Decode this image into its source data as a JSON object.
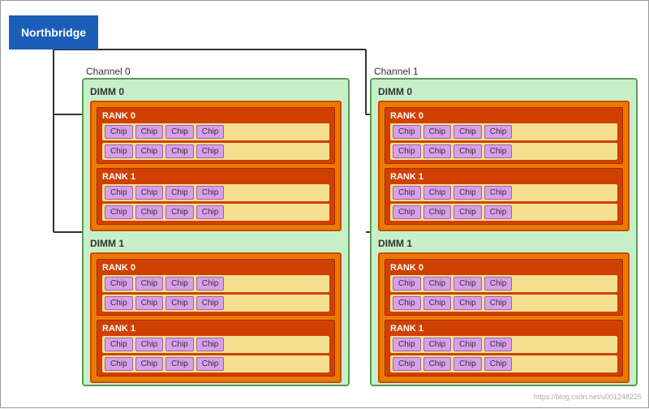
{
  "northbridge": {
    "label": "Northbridge"
  },
  "channels": [
    {
      "id": "channel-0",
      "label": "Channel 0",
      "dimms": [
        {
          "label": "DIMM 0",
          "ranks": [
            {
              "label": "RANK 0",
              "rows": [
                [
                  "Chip",
                  "Chip",
                  "Chip",
                  "Chip"
                ],
                [
                  "Chip",
                  "Chip",
                  "Chip",
                  "Chip"
                ]
              ]
            },
            {
              "label": "RANK 1",
              "rows": [
                [
                  "Chip",
                  "Chip",
                  "Chip",
                  "Chip"
                ],
                [
                  "Chip",
                  "Chip",
                  "Chip",
                  "Chip"
                ]
              ]
            }
          ]
        },
        {
          "label": "DIMM 1",
          "ranks": [
            {
              "label": "RANK 0",
              "rows": [
                [
                  "Chip",
                  "Chip",
                  "Chip",
                  "Chip"
                ],
                [
                  "Chip",
                  "Chip",
                  "Chip",
                  "Chip"
                ]
              ]
            },
            {
              "label": "RANK 1",
              "rows": [
                [
                  "Chip",
                  "Chip",
                  "Chip",
                  "Chip"
                ],
                [
                  "Chip",
                  "Chip",
                  "Chip",
                  "Chip"
                ]
              ]
            }
          ]
        }
      ]
    },
    {
      "id": "channel-1",
      "label": "Channel 1",
      "dimms": [
        {
          "label": "DIMM 0",
          "ranks": [
            {
              "label": "RANK 0",
              "rows": [
                [
                  "Chip",
                  "Chip",
                  "Chip",
                  "Chip"
                ],
                [
                  "Chip",
                  "Chip",
                  "Chip",
                  "Chip"
                ]
              ]
            },
            {
              "label": "RANK 1",
              "rows": [
                [
                  "Chip",
                  "Chip",
                  "Chip",
                  "Chip"
                ],
                [
                  "Chip",
                  "Chip",
                  "Chip",
                  "Chip"
                ]
              ]
            }
          ]
        },
        {
          "label": "DIMM 1",
          "ranks": [
            {
              "label": "RANK 0",
              "rows": [
                [
                  "Chip",
                  "Chip",
                  "Chip",
                  "Chip"
                ],
                [
                  "Chip",
                  "Chip",
                  "Chip",
                  "Chip"
                ]
              ]
            },
            {
              "label": "RANK 1",
              "rows": [
                [
                  "Chip",
                  "Chip",
                  "Chip",
                  "Chip"
                ],
                [
                  "Chip",
                  "Chip",
                  "Chip",
                  "Chip"
                ]
              ]
            }
          ]
        }
      ]
    }
  ],
  "watermark": "https://blog.csdn.net/u001248225"
}
